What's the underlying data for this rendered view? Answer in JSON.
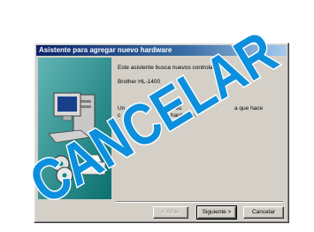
{
  "window": {
    "title": "Asistente para agregar nuevo hardware"
  },
  "body": {
    "line1": "Este asistente busca nuevos controlado",
    "device": "Brother HL-1400",
    "line3a": "Un",
    "line3b": "o es",
    "line3c": "a que hace",
    "line4a": "c",
    "line4b": "hardware."
  },
  "buttons": {
    "back": "< Atrás",
    "next": "Siguiente >",
    "cancel": "Cancelar"
  },
  "overlay": {
    "stamp_text": "CANCELAR",
    "stamp_color": "#0c8fdd"
  },
  "icons": {
    "illustration": "computer-with-cds-icon"
  }
}
